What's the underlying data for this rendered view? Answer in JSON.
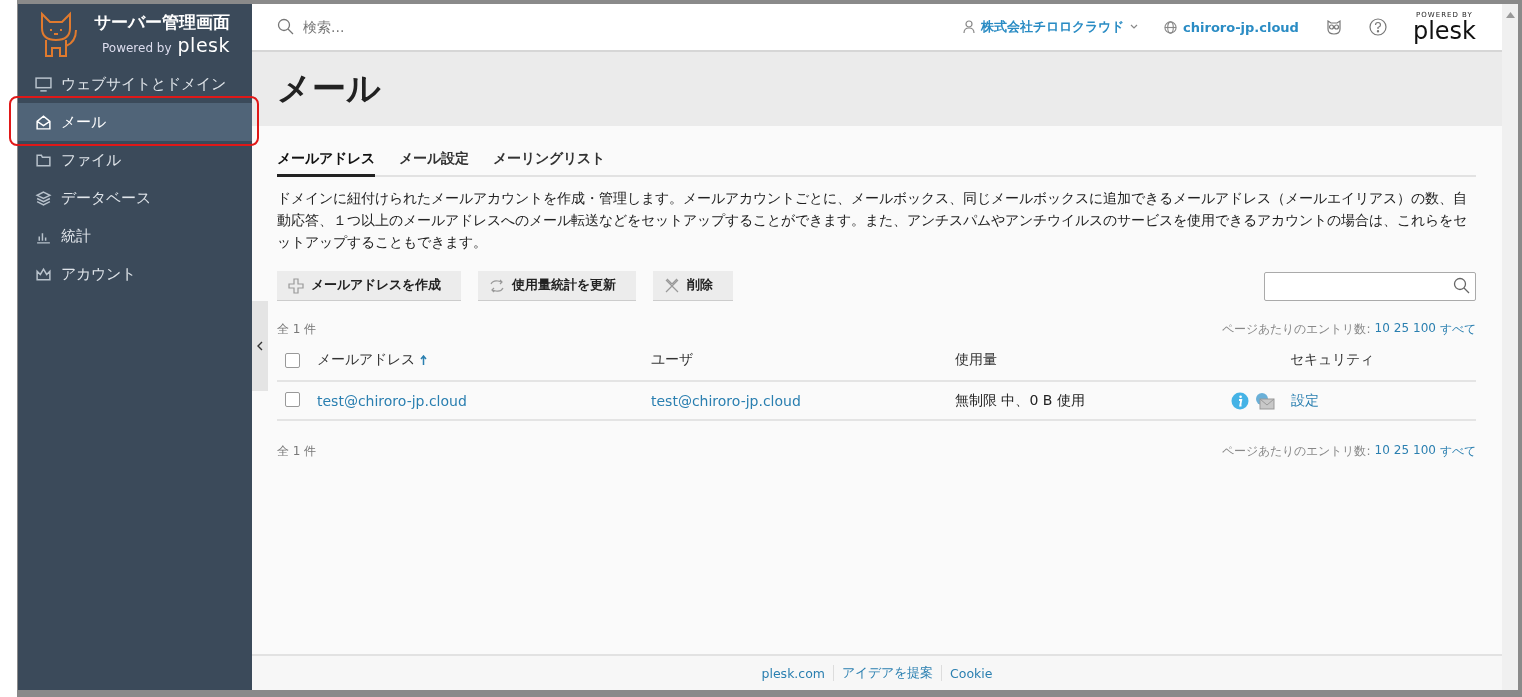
{
  "sidebar": {
    "logo_title": "サーバー管理画面",
    "powered_by": "Powered by",
    "brand": "plesk",
    "items": [
      {
        "label": "ウェブサイトとドメイン",
        "selected": false,
        "highlighted": false
      },
      {
        "label": "メール",
        "selected": true,
        "highlighted": true
      },
      {
        "label": "ファイル",
        "selected": false,
        "highlighted": false
      },
      {
        "label": "データベース",
        "selected": false,
        "highlighted": false
      },
      {
        "label": "統計",
        "selected": false,
        "highlighted": false
      },
      {
        "label": "アカウント",
        "selected": false,
        "highlighted": false
      }
    ]
  },
  "header": {
    "search": {
      "placeholder": "検索..."
    },
    "account": "株式会社チロロクラウド",
    "domain": "chiroro-jp.cloud",
    "powered_by": "POWERED BY",
    "brand": "plesk"
  },
  "page": {
    "title": "メール"
  },
  "tabs": [
    {
      "label": "メールアドレス",
      "selected": true
    },
    {
      "label": "メール設定",
      "selected": false
    },
    {
      "label": "メーリングリスト",
      "selected": false
    }
  ],
  "description": "ドメインに紐付けられたメールアカウントを作成・管理します。メールアカウントごとに、メールボックス、同じメールボックスに追加できるメールアドレス（メールエイリアス）の数、自動応答、１つ以上のメールアドレスへのメール転送などをセットアップすることができます。また、アンチスパムやアンチウイルスのサービスを使用できるアカウントの場合は、これらをセットアップすることもできます。",
  "toolbar": {
    "buttons": [
      {
        "label": "メールアドレスを作成"
      },
      {
        "label": "使用量統計を更新"
      },
      {
        "label": "削除"
      }
    ]
  },
  "list": {
    "summary_top": "全 1 件",
    "summary_bottom": "全 1 件",
    "per_page_top": {
      "label": "ページあたりのエントリ数:",
      "options": [
        "10",
        "25",
        "100",
        "すべて"
      ]
    },
    "per_page_bottom": {
      "label": "ページあたりのエントリ数:",
      "options": [
        "10",
        "25",
        "100",
        "すべて"
      ]
    },
    "header_checked": false,
    "columns": [
      {
        "label": "メールアドレス",
        "sorted": true
      },
      {
        "label": "ユーザ",
        "sorted": false
      },
      {
        "label": "使用量",
        "sorted": false
      },
      {
        "label": "セキュリティ",
        "sorted": false
      }
    ],
    "rows": [
      {
        "checked": false,
        "email": "test@chiroro-jp.cloud",
        "user": "test@chiroro-jp.cloud",
        "usage": "無制限 中、0 B 使用",
        "security_link": "設定"
      }
    ]
  },
  "footer": {
    "links": [
      "plesk.com",
      "アイデアを提案",
      "Cookie"
    ]
  }
}
